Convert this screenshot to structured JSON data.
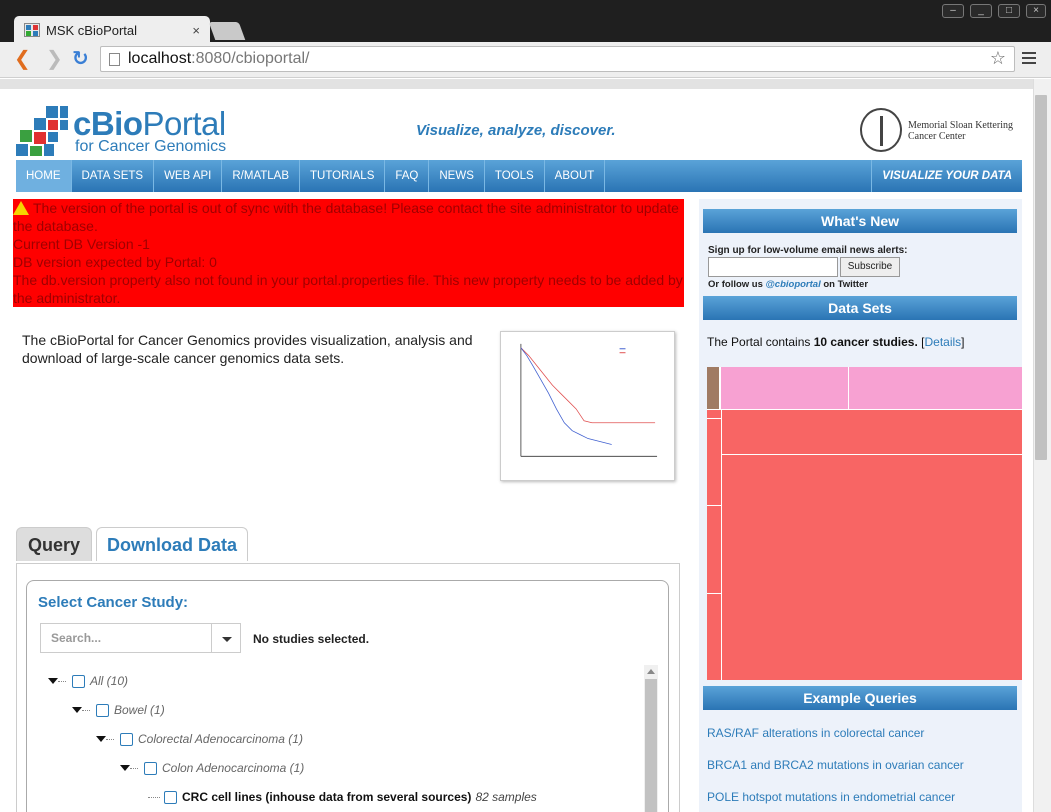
{
  "browser": {
    "tab_title": "MSK cBioPortal",
    "tab_close": "×",
    "url_host": "localhost",
    "url_rest": ":8080/cbioportal/",
    "back": "❮",
    "forward": "❯",
    "reload": "↻",
    "star": "☆"
  },
  "header": {
    "logo_text_bold": "cBio",
    "logo_text_regular": "Portal",
    "logo_sub": "for Cancer Genomics",
    "tagline": "Visualize, analyze, discover.",
    "mskcc_line1": "Memorial Sloan Kettering",
    "mskcc_line2": "Cancer Center",
    "colors": {
      "brand": "#2d7cb9"
    }
  },
  "nav": {
    "items": [
      "HOME",
      "DATA SETS",
      "WEB API",
      "R/MATLAB",
      "TUTORIALS",
      "FAQ",
      "NEWS",
      "TOOLS",
      "ABOUT"
    ],
    "active": "HOME",
    "right": "VISUALIZE YOUR DATA"
  },
  "error": {
    "line1": "The version of the portal is out of sync with the database! Please contact the site administrator to update the database.",
    "line2": "Current DB Version -1",
    "line3": "DB version expected by Portal: 0",
    "line4": "The db.version property also not found in your portal.properties file. This new property needs to be added by the administrator.",
    "color_bg": "#ff0000",
    "color_text": "#a00000"
  },
  "intro": {
    "text": "The cBioPortal for Cancer Genomics provides visualization, analysis and download of large-scale cancer genomics data sets."
  },
  "query": {
    "tab_query": "Query",
    "tab_download": "Download Data",
    "select_title": "Select Cancer Study:",
    "search_placeholder": "Search...",
    "no_studies": "No studies selected.",
    "tree": [
      {
        "label": "All (10)"
      },
      {
        "label": "Bowel (1)"
      },
      {
        "label": "Colorectal Adenocarcinoma (1)"
      },
      {
        "label": "Colon Adenocarcinoma (1)"
      }
    ],
    "leaf": {
      "name": "CRC cell lines (inhouse data from several sources)",
      "samples": "82 samples"
    }
  },
  "sidebar": {
    "whats_new": "What's New",
    "signup": "Sign up for low-volume email news alerts:",
    "subscribe": "Subscribe",
    "follow_prefix": "Or follow us",
    "twitter": "@cbioportal",
    "follow_suffix": "on Twitter",
    "data_sets": "Data Sets",
    "contains_prefix": "The Portal contains",
    "contains_bold": "10 cancer studies.",
    "details_open": "[",
    "details_link": "Details",
    "details_close": "]",
    "example_queries": "Example Queries",
    "examples": [
      "RAS/RAF alterations in colorectal cancer",
      "BRCA1 and BRCA2 mutations in ovarian cancer",
      "POLE hotspot mutations in endometrial cancer"
    ],
    "treemap_colors": {
      "brown": "#a07b63",
      "pink": "#f7a1d2",
      "red": "#f86564"
    }
  }
}
